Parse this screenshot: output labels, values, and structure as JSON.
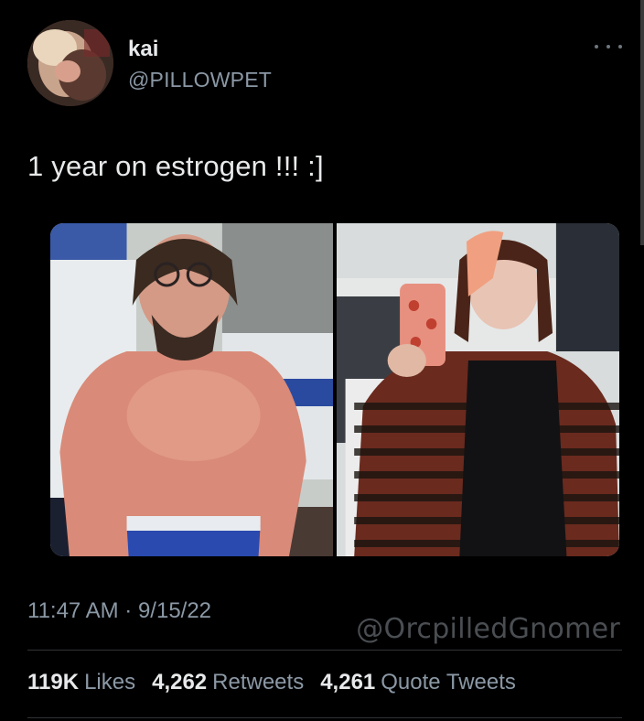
{
  "tweet": {
    "display_name": "kai",
    "handle": "@PILLOWPET",
    "text": "1 year on estrogen !!! :]",
    "timestamp": "11:47 AM · 9/15/22"
  },
  "stats": {
    "likes": {
      "count": "119K",
      "label": "Likes"
    },
    "retweets": {
      "count": "4,262",
      "label": "Retweets"
    },
    "quotes": {
      "count": "4,261",
      "label": "Quote Tweets"
    }
  },
  "watermark": "@OrcpilledGnomer",
  "colors": {
    "background": "#000000",
    "primary_text": "#e7e9ea",
    "secondary_text": "#8b98a5",
    "divider": "#2f3336"
  },
  "icons": {
    "more": "more-horizontal-icon"
  }
}
